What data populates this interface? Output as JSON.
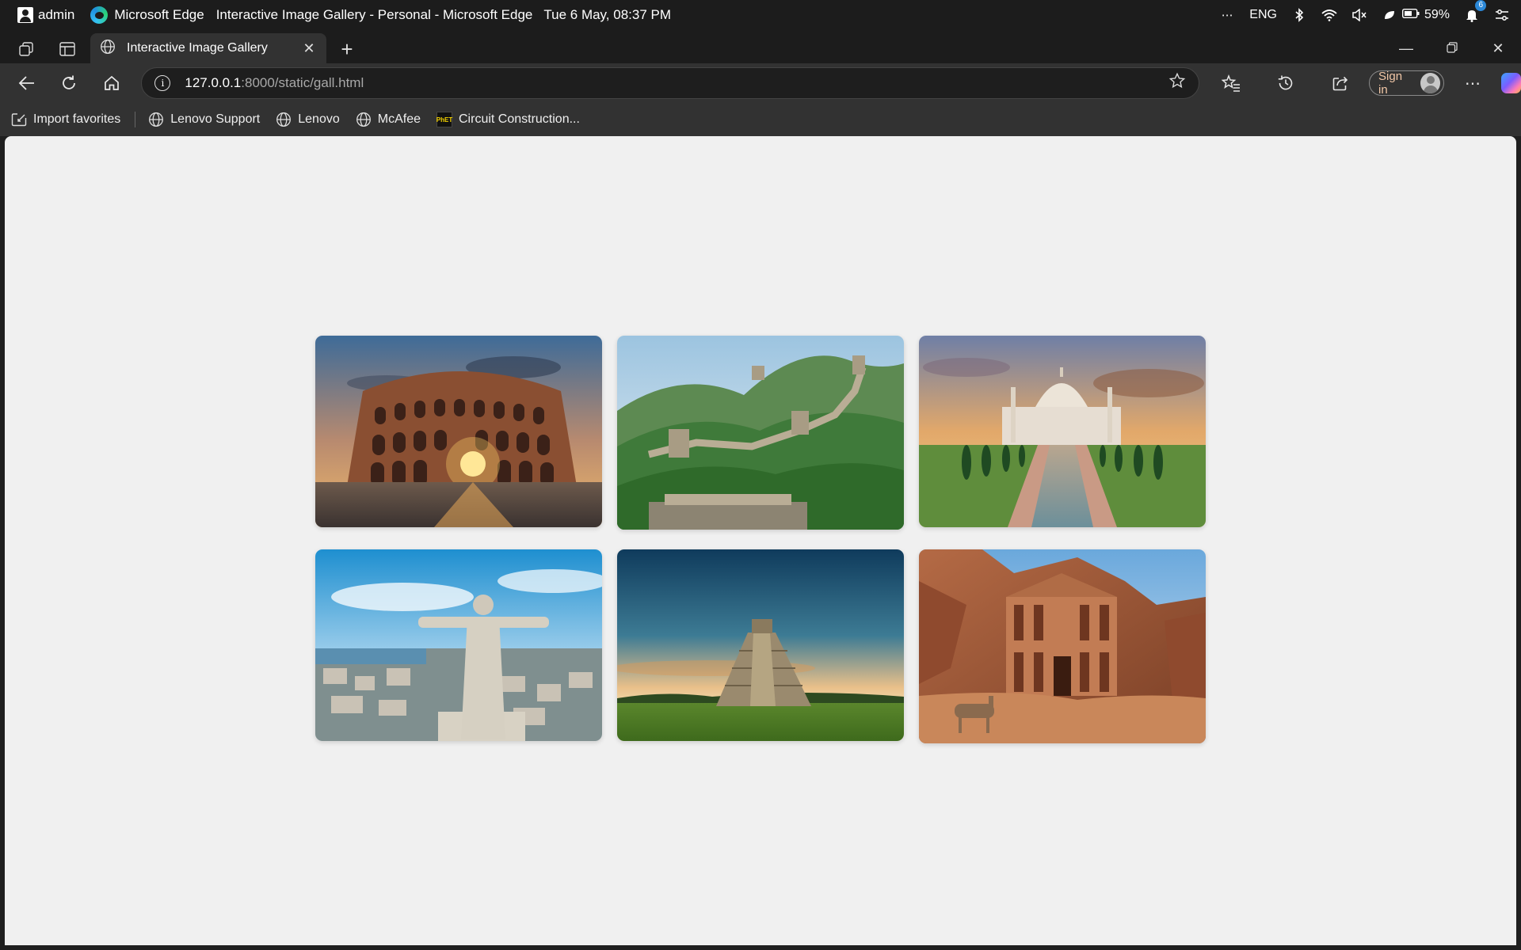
{
  "os": {
    "user": "admin",
    "app_name": "Microsoft Edge",
    "window_title": "Interactive Image Gallery - Personal - Microsoft Edge",
    "datetime": "Tue 6 May, 08:37 PM",
    "language": "ENG",
    "battery": "59%",
    "notification_count": "6"
  },
  "browser": {
    "tab_title": "Interactive Image Gallery",
    "url_host": "127.0.0.1",
    "url_rest": ":8000/static/gall.html",
    "sign_in_label": "Sign in"
  },
  "favorites": [
    {
      "label": "Import favorites",
      "icon": "import-icon"
    },
    {
      "label": "Lenovo Support",
      "icon": "globe-icon"
    },
    {
      "label": "Lenovo",
      "icon": "globe-icon"
    },
    {
      "label": "McAfee",
      "icon": "globe-icon"
    },
    {
      "label": "Circuit Construction...",
      "icon": "phet-icon"
    }
  ],
  "gallery": {
    "images": [
      {
        "subject": "Colosseum at sunset"
      },
      {
        "subject": "Great Wall of China"
      },
      {
        "subject": "Taj Mahal with reflecting pool"
      },
      {
        "subject": "Christ statue overlooking city"
      },
      {
        "subject": "Chichen Itza pyramid"
      },
      {
        "subject": "Petra monastery with camel"
      }
    ]
  }
}
